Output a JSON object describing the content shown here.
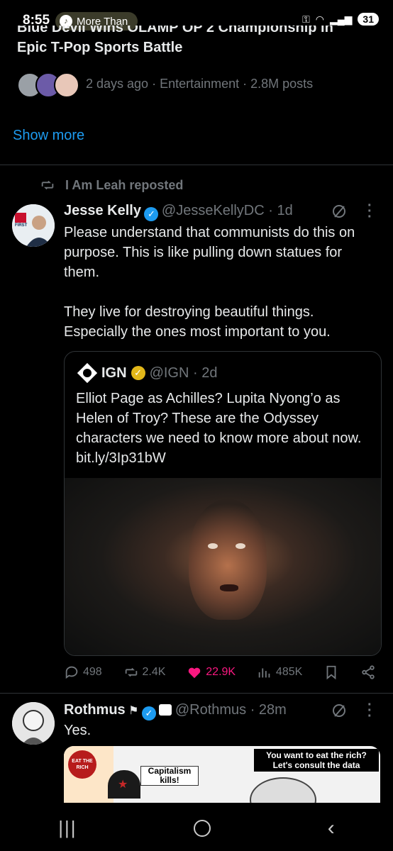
{
  "status": {
    "time": "8:55",
    "notification": "More Than",
    "battery": "31"
  },
  "trend": {
    "title_line1": "Blue Devil Wins OLAMP OP 2 Championship in",
    "title_line2": "Epic T-Pop Sports Battle",
    "meta": "2 days ago · Entertainment · 2.8M posts"
  },
  "show_more": "Show more",
  "tweet1": {
    "repost_label": "I Am Leah reposted",
    "name": "Jesse Kelly",
    "handle": "@JesseKellyDC · 1d",
    "avatar_text": "FIRST",
    "text": "Please understand that communists do this on purpose. This is like pulling down statues for them.\n\nThey live for destroying beautiful things. Especially the ones most important to you.",
    "quote": {
      "name": "IGN",
      "handle": "@IGN · 2d",
      "text": "Elliot Page as Achilles? Lupita Nyong’o as Helen of Troy? These are the Odyssey characters we need to know more about now. bit.ly/3Ip31bW"
    },
    "stats": {
      "replies": "498",
      "reposts": "2.4K",
      "likes": "22.9K",
      "views": "485K"
    }
  },
  "tweet2": {
    "name": "Rothmus",
    "handle": "@Rothmus · 28m",
    "text": "Yes.",
    "meme": {
      "sign_text": "EAT THE RICH",
      "caption_left": "Capitalism kills!",
      "caption_right": "You want to eat the rich? Let's consult the data"
    }
  },
  "colors": {
    "accent": "#1d9bf0",
    "like": "#f91880",
    "muted": "#71767b"
  },
  "icons": [
    "retweet-icon",
    "verified-icon",
    "grok-icon",
    "more-icon",
    "reply-icon",
    "like-icon",
    "views-icon",
    "bookmark-icon",
    "share-icon",
    "recents-icon",
    "home-icon",
    "back-icon"
  ]
}
